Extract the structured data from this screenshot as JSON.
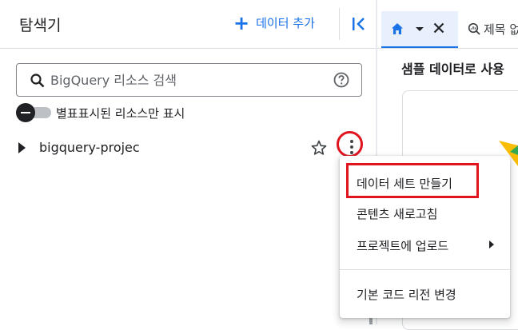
{
  "explorer": {
    "title": "탐색기",
    "add_data_label": "데이터 추가",
    "search": {
      "placeholder": "BigQuery 리소스 검색",
      "value": ""
    },
    "starred_toggle": {
      "label": "별표표시된 리소스만 표시",
      "on": false
    },
    "project": {
      "name": "bigquery-project"
    }
  },
  "tabs": [
    {
      "icon": "home-icon",
      "active": true
    },
    {
      "icon": "query-icon",
      "label": "제목 없음"
    }
  ],
  "main": {
    "heading": "샘플 데이터로 사용"
  },
  "context_menu": {
    "items": [
      {
        "label": "데이터 세트 만들기",
        "highlighted": true
      },
      {
        "label": "콘텐츠 새로고침"
      },
      {
        "label": "프로젝트에 업로드",
        "has_submenu": true
      },
      {
        "label": "기본 코드 리전 변경"
      }
    ]
  },
  "colors": {
    "accent": "#1a73e8",
    "highlight": "#e0141e",
    "active_tab_bg": "#e8f0fe"
  }
}
